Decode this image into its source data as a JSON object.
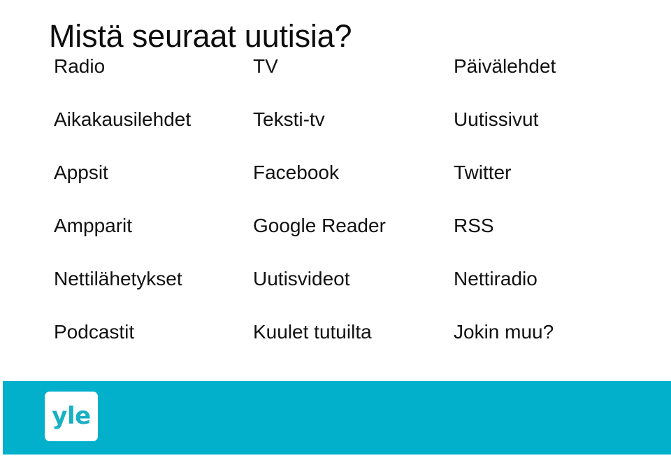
{
  "slide": {
    "title": "Mistä seuraat uutisia?",
    "background_color": "#ffffff",
    "text_color": "#111111",
    "accent_color": "#03b0cb"
  },
  "table": {
    "columns": [
      {
        "header": "Radio"
      },
      {
        "header": "TV"
      },
      {
        "header": "Päivälehdet"
      }
    ],
    "rows": [
      [
        "Radio",
        "TV",
        "Päivälehdet"
      ],
      [
        "Aikakausilehdet",
        "Teksti-tv",
        "Uutissivut"
      ],
      [
        "Appsit",
        "Facebook",
        "Twitter"
      ],
      [
        "Ampparit",
        "Google Reader",
        "RSS"
      ],
      [
        "Nettilähetykset",
        "Uutisvideot",
        "Nettiradio"
      ],
      [
        "Podcastit",
        "Kuulet tutuilta",
        "Jokin muu?"
      ]
    ]
  },
  "footer": {
    "band_color": "#03b0cb",
    "logo": {
      "text": "yle",
      "text_color": "#18b0c4",
      "plate_color": "#ffffff"
    }
  }
}
